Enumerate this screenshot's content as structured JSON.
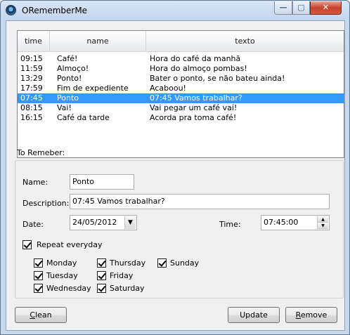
{
  "window": {
    "title": "ORememberMe"
  },
  "titlebar_buttons": {
    "minimize": "—",
    "maximize": "▢",
    "close": "✕"
  },
  "list": {
    "columns": [
      "time",
      "name",
      "texto"
    ],
    "rows": [
      {
        "time": "09:15",
        "name": "Café!",
        "texto": "Hora do café da manhã"
      },
      {
        "time": "11:59",
        "name": "Almoço!",
        "texto": "Hora do almoço pombas!"
      },
      {
        "time": "13:29",
        "name": "Ponto!",
        "texto": "Bater o ponto, se não bateu ainda!"
      },
      {
        "time": "17:59",
        "name": "Fim de expediente",
        "texto": "Acaboou!"
      },
      {
        "time": "07:45",
        "name": "Ponto",
        "texto": "07:45 Vamos trabalhar?"
      },
      {
        "time": "08:15",
        "name": "Vai!",
        "texto": "Vai pegar um café vai!"
      },
      {
        "time": "16:15",
        "name": "Café da tarde",
        "texto": "Acorda pra toma café!"
      }
    ],
    "selected_index": 4
  },
  "form": {
    "section_label": "To Remeber:",
    "name_label": "Name:",
    "name_value": "Ponto",
    "description_label": "Description:",
    "description_value": "07:45 Vamos trabalhar?",
    "date_label": "Date:",
    "date_value": "24/05/2012",
    "time_label": "Time:",
    "time_value": "07:45:00",
    "repeat_label": "Repeat everyday",
    "days": {
      "monday": "Monday",
      "tuesday": "Tuesday",
      "wednesday": "Wednesday",
      "thursday": "Thursday",
      "friday": "Friday",
      "saturday": "Saturday",
      "sunday": "Sunday"
    }
  },
  "buttons": {
    "clean_first": "C",
    "clean_rest": "lean",
    "update": "Update",
    "remove_first": "R",
    "remove_rest": "emove"
  },
  "colors": {
    "selection": "#3399ff",
    "window_frame": "#c9d9ec",
    "close_button": "#c7432c"
  }
}
